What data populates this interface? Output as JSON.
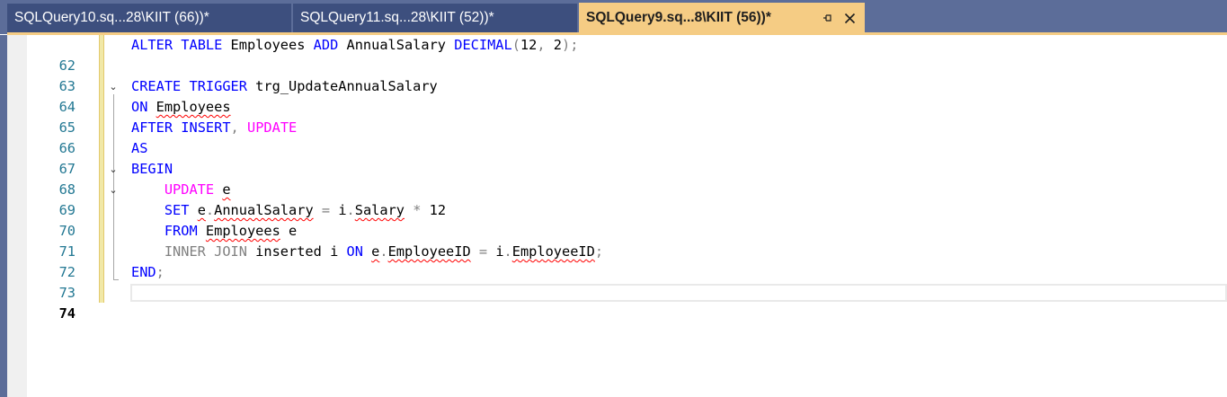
{
  "tabs": [
    {
      "label": "SQLQuery10.sq...28\\KIIT (66))*",
      "active": false
    },
    {
      "label": "SQLQuery11.sq...28\\KIIT (52))*",
      "active": false
    },
    {
      "label": "SQLQuery9.sq...8\\KIIT (56))*",
      "active": true
    }
  ],
  "tab_icons": {
    "pin": "pin-icon",
    "close": "close-icon"
  },
  "colors": {
    "tabstrip": "#5c6d99",
    "inactive_tab": "#3d4f7e",
    "active_tab": "#f5cc84",
    "keyword": "#0000ff",
    "function": "#ff00ff",
    "operator": "#808080",
    "line_number": "#237893",
    "squiggle": "#ff0000"
  },
  "editor": {
    "current_line": "74",
    "lines": [
      {
        "n": "62",
        "t": [
          "ALTER",
          " ",
          "TABLE",
          " Employees ",
          "ADD",
          " AnnualSalary ",
          "DECIMAL",
          "(",
          "12",
          ",",
          " 2",
          ");"
        ]
      },
      {
        "n": "63",
        "t": []
      },
      {
        "n": "64",
        "t": [
          "CREATE",
          " ",
          "TRIGGER",
          " trg_UpdateAnnualSalary"
        ]
      },
      {
        "n": "65",
        "t": [
          "ON",
          " ",
          "Employees"
        ]
      },
      {
        "n": "66",
        "t": [
          "AFTER",
          " ",
          "INSERT",
          ",",
          " ",
          "UPDATE"
        ]
      },
      {
        "n": "67",
        "t": [
          "AS"
        ]
      },
      {
        "n": "68",
        "t": [
          "BEGIN"
        ]
      },
      {
        "n": "69",
        "t": [
          "    ",
          "UPDATE",
          " ",
          "e"
        ]
      },
      {
        "n": "70",
        "t": [
          "    ",
          "SET",
          " ",
          "e",
          ".",
          "AnnualSalary",
          " ",
          "=",
          " ",
          "i",
          ".",
          "Salary",
          " ",
          "*",
          " 12"
        ]
      },
      {
        "n": "71",
        "t": [
          "    ",
          "FROM",
          " ",
          "Employees",
          " e"
        ]
      },
      {
        "n": "72",
        "t": [
          "    ",
          "INNER",
          " ",
          "JOIN",
          " inserted i ",
          "ON",
          " ",
          "e",
          ".",
          "EmployeeID",
          " ",
          "=",
          " i",
          ".",
          "EmployeeID",
          ";"
        ]
      },
      {
        "n": "73",
        "t": [
          "END",
          ";"
        ]
      },
      {
        "n": "74",
        "t": []
      }
    ]
  }
}
